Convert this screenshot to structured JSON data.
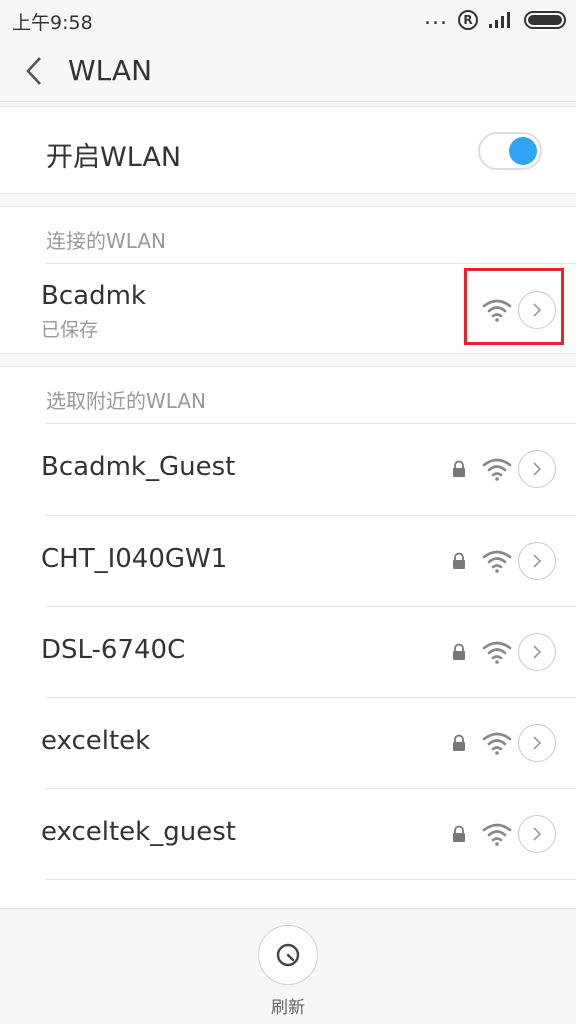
{
  "status_bar": {
    "time": "上午9:58",
    "dots": "...",
    "registered_mark": "R"
  },
  "header": {
    "title": "WLAN"
  },
  "wlan_toggle": {
    "label": "开启WLAN",
    "enabled": true,
    "color": "#31a3f4"
  },
  "connected_section": {
    "title": "连接的WLAN",
    "network": {
      "name": "Bcadmk",
      "status": "已保存"
    }
  },
  "nearby_section": {
    "title": "选取附近的WLAN",
    "networks": [
      {
        "name": "Bcadmk_Guest",
        "secured": true
      },
      {
        "name": "CHT_I040GW1",
        "secured": true
      },
      {
        "name": "DSL-6740C",
        "secured": true
      },
      {
        "name": "exceltek",
        "secured": true
      },
      {
        "name": "exceltek_guest",
        "secured": true
      }
    ]
  },
  "bottom": {
    "refresh_label": "刷新"
  },
  "icons": {
    "back": "chevron-left-icon",
    "wifi": "wifi-signal-icon",
    "lock": "lock-icon",
    "detail": "chevron-right-icon",
    "refresh": "refresh-icon"
  },
  "highlight_color": "#e8232c"
}
